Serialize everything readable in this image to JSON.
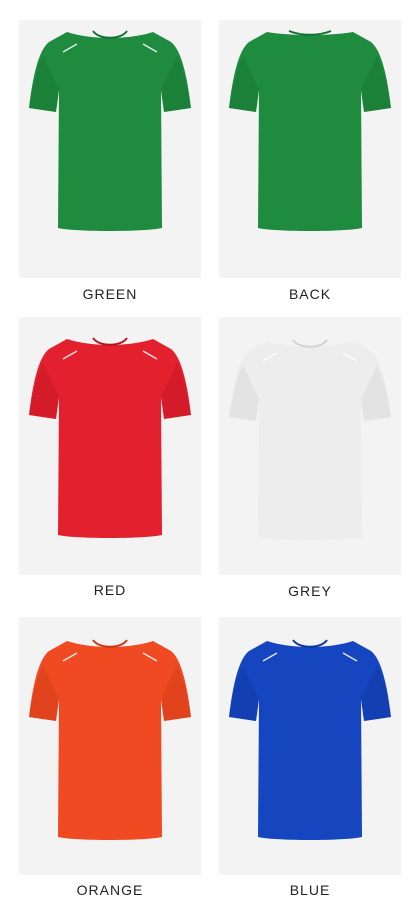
{
  "products": [
    {
      "label": "GREEN",
      "color": "#1f8b3f",
      "shade": "#15702f",
      "view": "front"
    },
    {
      "label": "BACK",
      "color": "#1f8b3f",
      "shade": "#15702f",
      "view": "back"
    },
    {
      "label": "RED",
      "color": "#e3202e",
      "shade": "#b8141f",
      "view": "front"
    },
    {
      "label": "GREY",
      "color": "#ededed",
      "shade": "#d2d2d2",
      "view": "front"
    },
    {
      "label": "ORANGE",
      "color": "#ef4a22",
      "shade": "#c93814",
      "view": "front"
    },
    {
      "label": "BLUE",
      "color": "#1546c0",
      "shade": "#0e3597",
      "view": "front"
    }
  ]
}
